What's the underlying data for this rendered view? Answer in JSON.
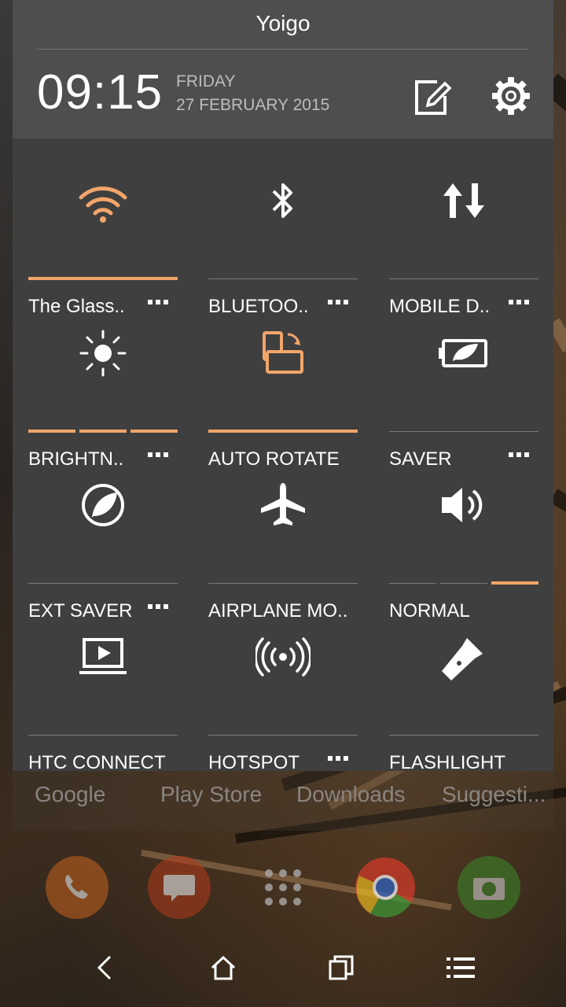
{
  "status": {
    "carrier": "Yoigo"
  },
  "header": {
    "time": "09:15",
    "day": "FRIDAY",
    "date": "27 FEBRUARY 2015",
    "icons": [
      "edit-icon",
      "settings-icon"
    ]
  },
  "tiles": [
    {
      "label": "The Glass..",
      "icon": "wifi-icon",
      "active": true,
      "has_more": true
    },
    {
      "label": "BLUETOO..",
      "icon": "bluetooth-icon",
      "active": false,
      "has_more": true
    },
    {
      "label": "MOBILE D..",
      "icon": "mobile-data-icon",
      "active": false,
      "has_more": true
    },
    {
      "label": "BRIGHTN..",
      "icon": "brightness-icon",
      "level_segments_on": 3,
      "level_segments_total": 3,
      "has_more": true
    },
    {
      "label": "AUTO ROTATE",
      "icon": "auto-rotate-icon",
      "active": true,
      "has_more": false
    },
    {
      "label": "SAVER",
      "icon": "power-saver-icon",
      "active": false,
      "has_more": true
    },
    {
      "label": "EXT SAVER",
      "icon": "extreme-saver-icon",
      "active": false,
      "has_more": true
    },
    {
      "label": "AIRPLANE MO..",
      "icon": "airplane-icon",
      "active": false,
      "has_more": false
    },
    {
      "label": "NORMAL",
      "icon": "volume-icon",
      "level_segments_on": 1,
      "level_segments_total": 3,
      "has_more": false
    },
    {
      "label": "HTC CONNECT",
      "icon": "htc-connect-icon",
      "active": false,
      "has_more": false
    },
    {
      "label": "HOTSPOT",
      "icon": "hotspot-icon",
      "active": false,
      "has_more": true
    },
    {
      "label": "FLASHLIGHT",
      "icon": "flashlight-icon",
      "active": false,
      "has_more": false
    }
  ],
  "home": {
    "shortcuts": [
      "Google",
      "Play Store",
      "Downloads",
      "Suggesti..."
    ],
    "dock": [
      "phone-icon",
      "messages-icon",
      "app-drawer-icon",
      "chrome-icon",
      "camera-icon"
    ]
  },
  "navbar": [
    "back-icon",
    "home-icon",
    "recents-icon",
    "menu-icon"
  ],
  "colors": {
    "accent": "#f3a56a",
    "panel": "#3f3f3f",
    "header": "#4e4e4e"
  }
}
